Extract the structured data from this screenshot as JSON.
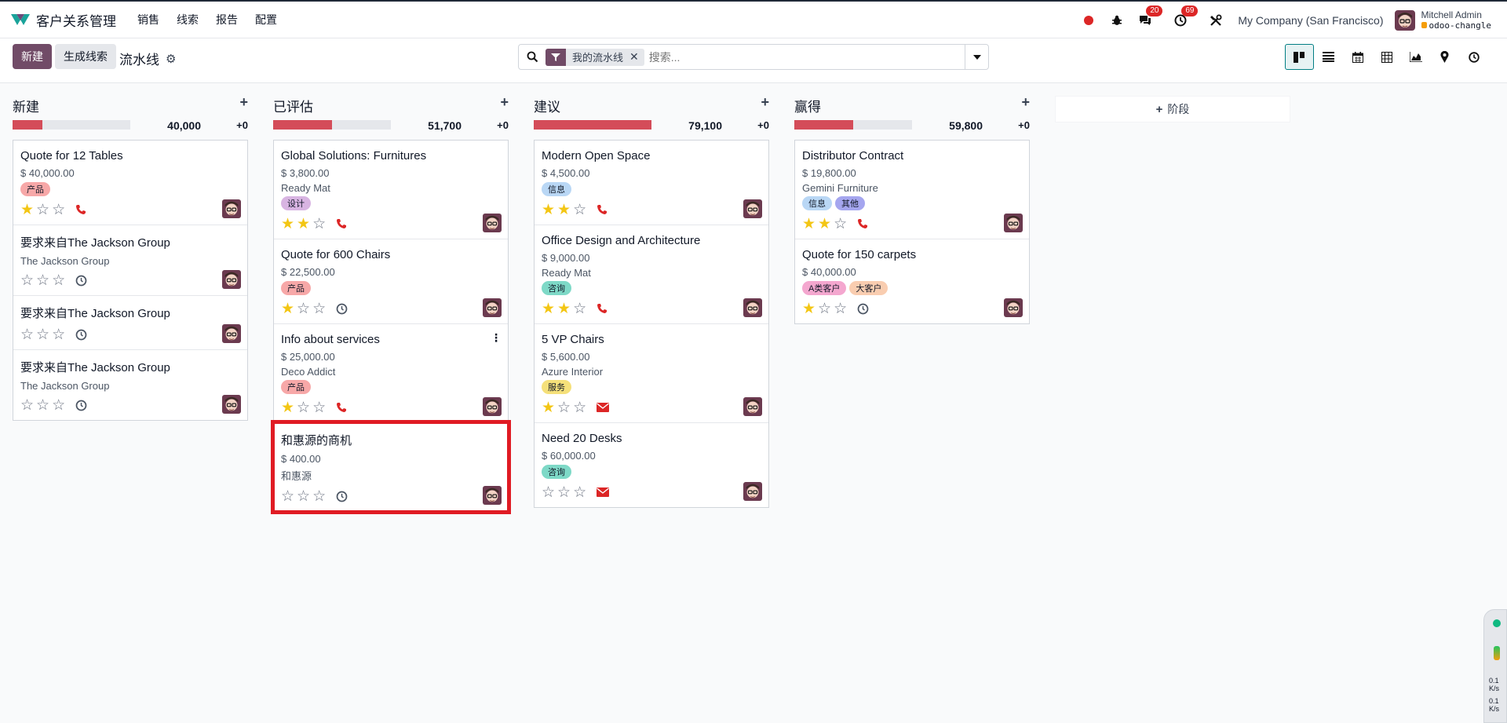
{
  "navbar": {
    "app_name": "客户关系管理",
    "menu": [
      "销售",
      "线索",
      "报告",
      "配置"
    ],
    "chat_badge": "20",
    "activity_badge": "69",
    "company": "My Company (San Francisco)",
    "user_name": "Mitchell Admin",
    "db_name": "odoo-changle"
  },
  "control": {
    "new_label": "新建",
    "generate_label": "生成线索",
    "breadcrumb": "流水线",
    "facet_label": "我的流水线",
    "search_placeholder": "搜索..."
  },
  "colors": {
    "brand": "#714b67",
    "progress": "#d44c59",
    "highlight": "#e01b24",
    "star": "#f3c614"
  },
  "columns": [
    {
      "title": "新建",
      "sum": "40,000",
      "plus": "+0",
      "progress_fraction": 0.25,
      "cards": [
        {
          "title": "Quote for 12 Tables",
          "amount": "$ 40,000.00",
          "partner": "",
          "tags": [
            {
              "label": "产品",
              "color": "#f7a8a8"
            }
          ],
          "stars": 1,
          "activity": "phone"
        },
        {
          "title": "要求来自The Jackson Group",
          "amount": "",
          "partner": "The Jackson Group",
          "tags": [],
          "stars": 0,
          "activity": "clock"
        },
        {
          "title": "要求来自The Jackson Group",
          "amount": "",
          "partner": "",
          "tags": [],
          "stars": 0,
          "activity": "clock"
        },
        {
          "title": "要求来自The Jackson Group",
          "amount": "",
          "partner": "The Jackson Group",
          "tags": [],
          "stars": 0,
          "activity": "clock"
        }
      ]
    },
    {
      "title": "已评估",
      "sum": "51,700",
      "plus": "+0",
      "progress_fraction": 0.5,
      "cards": [
        {
          "title": "Global Solutions: Furnitures",
          "amount": "$ 3,800.00",
          "partner": "Ready Mat",
          "tags": [
            {
              "label": "设计",
              "color": "#d8b4e2"
            }
          ],
          "stars": 2,
          "activity": "phone"
        },
        {
          "title": "Quote for 600 Chairs",
          "amount": "$ 22,500.00",
          "partner": "",
          "tags": [
            {
              "label": "产品",
              "color": "#f7a8a8"
            }
          ],
          "stars": 1,
          "activity": "clock"
        },
        {
          "title": "Info about services",
          "amount": "$ 25,000.00",
          "partner": "Deco Addict",
          "tags": [
            {
              "label": "产品",
              "color": "#f7a8a8"
            }
          ],
          "stars": 1,
          "activity": "phone",
          "menu": true
        },
        {
          "title": "和惠源的商机",
          "amount": "$ 400.00",
          "partner": "和惠源",
          "tags": [],
          "stars": 0,
          "activity": "clock",
          "highlight": true
        }
      ]
    },
    {
      "title": "建议",
      "sum": "79,100",
      "plus": "+0",
      "progress_fraction": 1.0,
      "cards": [
        {
          "title": "Modern Open Space",
          "amount": "$ 4,500.00",
          "partner": "",
          "tags": [
            {
              "label": "信息",
              "color": "#b9d7f5"
            }
          ],
          "stars": 2,
          "activity": "phone"
        },
        {
          "title": "Office Design and Architecture",
          "amount": "$ 9,000.00",
          "partner": "Ready Mat",
          "tags": [
            {
              "label": "咨询",
              "color": "#7ed9c7"
            }
          ],
          "stars": 2,
          "activity": "phone"
        },
        {
          "title": "5 VP Chairs",
          "amount": "$ 5,600.00",
          "partner": "Azure Interior",
          "tags": [
            {
              "label": "服务",
              "color": "#f5e07a"
            }
          ],
          "stars": 1,
          "activity": "mail"
        },
        {
          "title": "Need 20 Desks",
          "amount": "$ 60,000.00",
          "partner": "",
          "tags": [
            {
              "label": "咨询",
              "color": "#7ed9c7"
            }
          ],
          "stars": 0,
          "activity": "mail"
        }
      ]
    },
    {
      "title": "赢得",
      "sum": "59,800",
      "plus": "+0",
      "progress_fraction": 0.5,
      "cards": [
        {
          "title": "Distributor Contract",
          "amount": "$ 19,800.00",
          "partner": "Gemini Furniture",
          "tags": [
            {
              "label": "信息",
              "color": "#b9d7f5"
            },
            {
              "label": "其他",
              "color": "#a5a6ef"
            }
          ],
          "stars": 2,
          "activity": "phone"
        },
        {
          "title": "Quote for 150 carpets",
          "amount": "$ 40,000.00",
          "partner": "",
          "tags": [
            {
              "label": "A类客户",
              "color": "#f4a7cf"
            },
            {
              "label": "大客户",
              "color": "#f9cdb0"
            }
          ],
          "stars": 1,
          "activity": "clock"
        }
      ]
    }
  ],
  "add_stage_label": "阶段",
  "widget": {
    "up": "0.1",
    "up_unit": "K/s",
    "down": "0.1",
    "down_unit": "K/s"
  }
}
